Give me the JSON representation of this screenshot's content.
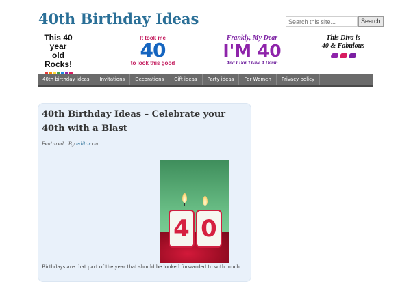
{
  "site": {
    "title": "40th Birthday Ideas"
  },
  "search": {
    "placeholder": "Search this site...",
    "button_label": "Search"
  },
  "banner": {
    "graphic1": {
      "line1": "This 40 year",
      "line2": "old Rocks!"
    },
    "graphic2": {
      "top": "It took me",
      "number": "40",
      "bottom": "to look this good"
    },
    "graphic3": {
      "line1": "Frankly, My Dear",
      "big": "I'M 40",
      "line3": "And I Don't Give A Damn"
    },
    "graphic4": {
      "line1": "This Diva is",
      "line2": "40 & Fabulous"
    },
    "colors": {
      "purple": "#8e24aa",
      "blue": "#1565c0",
      "pink": "#c2185b"
    }
  },
  "nav": {
    "items": [
      "40th birthday ideas",
      "Invitations",
      "Decorations",
      "Gift ideas",
      "Party ideas",
      "For Women",
      "Privacy policy"
    ]
  },
  "post": {
    "title": "40th Birthday Ideas – Celebrate your 40th with a Blast",
    "meta_category": "Featured",
    "meta_by": " | By ",
    "meta_author": "editor",
    "meta_on": " on",
    "image": {
      "candle1": "4",
      "candle2": "0"
    },
    "excerpt": "Birthdays are that part of the year that should be looked forwarded to with much"
  },
  "colors": {
    "accent": "#2a6f97",
    "nav_bg": "#6b6b6b",
    "post_bg": "#e9f1fa"
  }
}
